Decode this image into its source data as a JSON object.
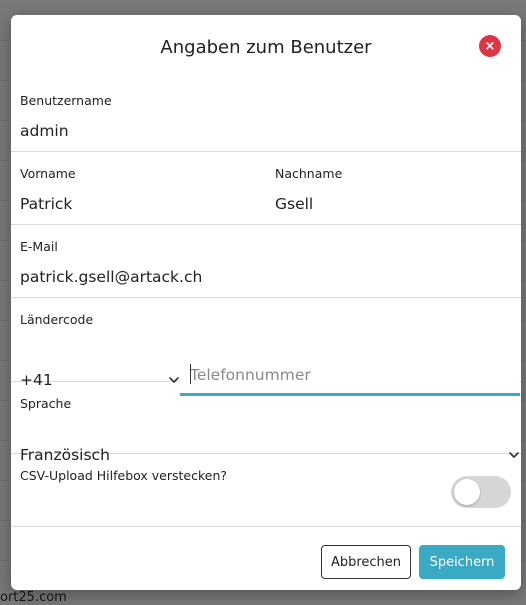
{
  "background": {
    "footer_text": "ort25.com"
  },
  "modal": {
    "title": "Angaben zum Benutzer",
    "close_symbol": "×",
    "username": {
      "label": "Benutzername",
      "value": "admin"
    },
    "firstname": {
      "label": "Vorname",
      "value": "Patrick"
    },
    "lastname": {
      "label": "Nachname",
      "value": "Gsell"
    },
    "email": {
      "label": "E-Mail",
      "value": "patrick.gsell@artack.ch"
    },
    "country_code": {
      "label": "Ländercode",
      "value": "+41"
    },
    "phone": {
      "placeholder": "Telefonnummer",
      "value": ""
    },
    "language": {
      "label": "Sprache",
      "value": "Französisch"
    },
    "csv_help": {
      "label": "CSV-Upload Hilfebox verstecken?",
      "enabled": false
    },
    "buttons": {
      "cancel": "Abbrechen",
      "save": "Speichern"
    }
  },
  "colors": {
    "accent": "#3aa9c4",
    "close": "#dc3545"
  },
  "icons": {
    "close": "close-icon",
    "select": "chevron-down-icon"
  }
}
